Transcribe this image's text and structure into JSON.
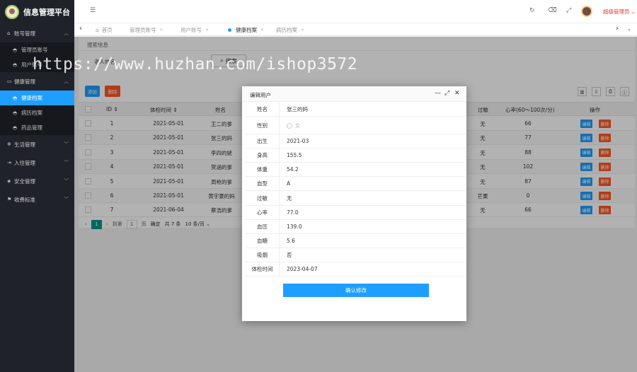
{
  "app": {
    "title": "信息管理平台"
  },
  "sidebar": {
    "groups": [
      {
        "label": "账号管理",
        "items": [
          "管理员账号",
          "用户账号"
        ]
      },
      {
        "label": "健康管理",
        "items": [
          "健康档案",
          "病历档案",
          "药品管理"
        ]
      },
      {
        "label": "生活管理"
      },
      {
        "label": "入住管理"
      },
      {
        "label": "安全管理"
      },
      {
        "label": "收费标准"
      }
    ]
  },
  "header": {
    "user_name": "超级管理员"
  },
  "tabs": [
    {
      "label": "首页"
    },
    {
      "label": "管理员账号"
    },
    {
      "label": "用户账号"
    },
    {
      "label": "健康档案",
      "active": true
    },
    {
      "label": "病历档案"
    }
  ],
  "search": {
    "section_label": "搜索信息",
    "field_label": "老人姓名",
    "button_label": "搜索"
  },
  "toolbar": {
    "add_label": "添加",
    "delete_label": "删除"
  },
  "table": {
    "headers": {
      "id": "ID",
      "check_date": "体检时间",
      "name": "姓名",
      "allergy": "过敏",
      "heart_rate": "心率(60～100次/分)",
      "actions": "操作"
    },
    "edit_label": "编辑",
    "delete_label": "删除",
    "rows": [
      {
        "id": "1",
        "date": "2021-05-01",
        "name": "王二的爹",
        "allergy": "无",
        "heart_rate": "66"
      },
      {
        "id": "2",
        "date": "2021-05-01",
        "name": "张三的妈",
        "allergy": "无",
        "heart_rate": "77"
      },
      {
        "id": "3",
        "date": "2021-05-01",
        "name": "李四的姥",
        "allergy": "无",
        "heart_rate": "88"
      },
      {
        "id": "4",
        "date": "2021-05-01",
        "name": "贺涵的爹",
        "allergy": "无",
        "heart_rate": "102"
      },
      {
        "id": "5",
        "date": "2021-05-01",
        "name": "周枪的爹",
        "allergy": "无",
        "heart_rate": "87"
      },
      {
        "id": "6",
        "date": "2021-05-01",
        "name": "黄宇豪的妈",
        "allergy": "芒果",
        "heart_rate": "0"
      },
      {
        "id": "7",
        "date": "2021-06-04",
        "name": "蔡浩的爹",
        "allergy": "无",
        "heart_rate": "66"
      }
    ]
  },
  "pager": {
    "current": "1",
    "goto_label": "到第",
    "page_input": "1",
    "page_unit": "页",
    "confirm": "确定",
    "total": "共 7 条",
    "per_page": "10 条/页"
  },
  "watermark": "https://www.huzhan.com/ishop3572",
  "modal": {
    "title": "编辑用户",
    "fields": [
      {
        "label": "姓名",
        "value": "张三的妈"
      },
      {
        "label": "性别",
        "value": "女",
        "type": "radio"
      },
      {
        "label": "出生",
        "value": "2021-03"
      },
      {
        "label": "身高",
        "value": "155.5"
      },
      {
        "label": "体重",
        "value": "54.2"
      },
      {
        "label": "血型",
        "value": "A"
      },
      {
        "label": "过敏",
        "value": "无"
      },
      {
        "label": "心率",
        "value": "77.0"
      },
      {
        "label": "血压",
        "value": "139.0"
      },
      {
        "label": "血糖",
        "value": "5.6"
      },
      {
        "label": "吸烟",
        "value": "否"
      },
      {
        "label": "体检时间",
        "value": "2023-04-07"
      }
    ],
    "confirm_label": "确认修改"
  }
}
